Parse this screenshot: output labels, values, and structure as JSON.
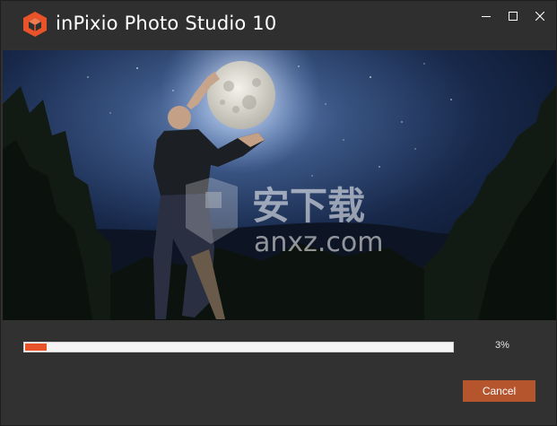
{
  "window": {
    "title": "inPixio Photo Studio 10",
    "controls": {
      "minimize_icon": "minimize-icon",
      "maximize_icon": "maximize-icon",
      "close_icon": "close-icon"
    }
  },
  "banner": {
    "watermark_text": "安下载",
    "watermark_url": "anxz.com"
  },
  "progress": {
    "percent_label": "3%",
    "fraction": 0.03
  },
  "actions": {
    "cancel_label": "Cancel"
  },
  "colors": {
    "accent": "#e8532a",
    "button": "#b5552e",
    "background": "#313131"
  }
}
